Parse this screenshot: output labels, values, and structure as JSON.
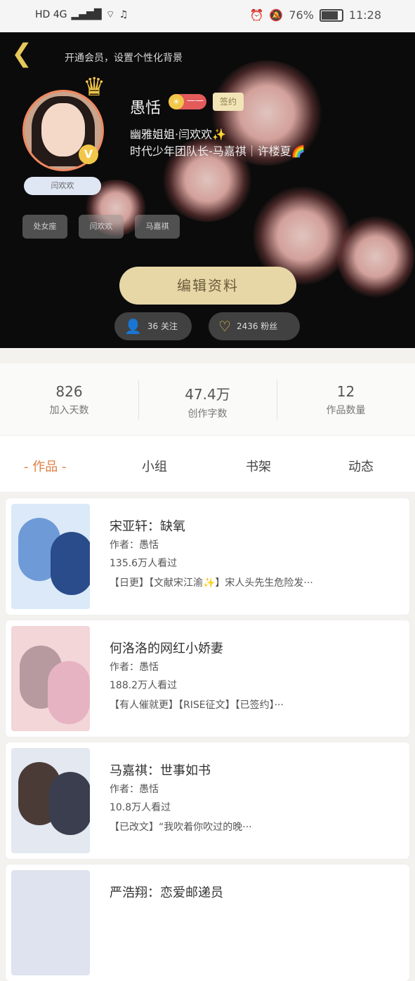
{
  "status": {
    "network": "HD 4G",
    "battery": "76%",
    "time": "11:28"
  },
  "hero": {
    "vip_tip": "开通会员，设置个性化背景",
    "username": "愚恬",
    "level": "——",
    "signed": "签约",
    "bio_line1": "幽雅姐姐·闫欢欢✨",
    "bio_line2": "时代少年团队长-马嘉祺｜许楼夏🌈",
    "nickname_tag": "闫欢欢",
    "tags": [
      "处女座",
      "闫欢欢",
      "马嘉祺"
    ],
    "edit_button": "编辑资料",
    "following": "36 关注",
    "likes": "2436 粉丝"
  },
  "stats": [
    {
      "value": "826",
      "label": "加入天数"
    },
    {
      "value": "47.4万",
      "label": "创作字数"
    },
    {
      "value": "12",
      "label": "作品数量"
    }
  ],
  "tabs": [
    "作品",
    "小组",
    "书架",
    "动态"
  ],
  "works": [
    {
      "title": "宋亚轩：缺氧",
      "author": "作者：愚恬",
      "reads": "135.6万人看过",
      "desc": "【日更】【文献宋江渝✨】宋人头先生危险发···"
    },
    {
      "title": "何洛洛的网红小娇妻",
      "author": "作者：愚恬",
      "reads": "188.2万人看过",
      "desc": "【有人催就更】【RISE征文】【已签约】···"
    },
    {
      "title": "马嘉祺：世事如书",
      "author": "作者：愚恬",
      "reads": "10.8万人看过",
      "desc": "【已改文】“我吹着你吹过的晚···"
    },
    {
      "title": "严浩翔：恋爱邮递员",
      "author": "",
      "reads": "",
      "desc": ""
    }
  ]
}
